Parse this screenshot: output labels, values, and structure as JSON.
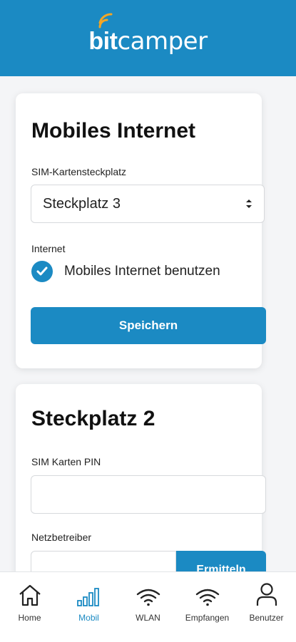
{
  "header": {
    "logo_bold": "bit",
    "logo_light": "camper"
  },
  "mobile_internet": {
    "title": "Mobiles Internet",
    "sim_slot_label": "SIM-Kartensteckplatz",
    "sim_slot_value": "Steckplatz 3",
    "internet_label": "Internet",
    "checkbox_label": "Mobiles Internet benutzen",
    "checkbox_checked": true,
    "save_label": "Speichern"
  },
  "slot2": {
    "title": "Steckplatz 2",
    "pin_label": "SIM Karten PIN",
    "pin_value": "",
    "provider_label": "Netzbetreiber",
    "provider_value": "",
    "detect_label": "Ermitteln"
  },
  "tabs": [
    {
      "label": "Home",
      "icon": "home-icon",
      "active": false
    },
    {
      "label": "Mobil",
      "icon": "signal-bars-icon",
      "active": true
    },
    {
      "label": "WLAN",
      "icon": "wifi-icon",
      "active": false
    },
    {
      "label": "Empfangen",
      "icon": "wifi-icon",
      "active": false
    },
    {
      "label": "Benutzer",
      "icon": "user-icon",
      "active": false
    }
  ],
  "colors": {
    "accent": "#1b8ac3",
    "background": "#f4f5f7"
  }
}
